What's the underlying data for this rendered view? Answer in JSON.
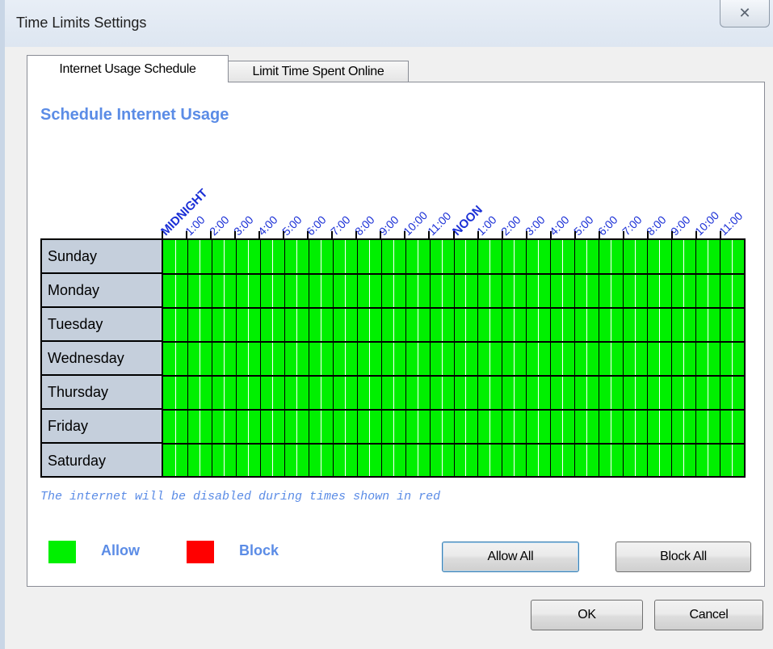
{
  "window": {
    "title": "Time Limits Settings",
    "close_glyph": "✕"
  },
  "tabs": [
    {
      "label": "Internet Usage Schedule",
      "active": true
    },
    {
      "label": "Limit Time Spent Online",
      "active": false
    }
  ],
  "schedule": {
    "title": "Schedule Internet Usage",
    "hour_labels": [
      "MIDNIGHT",
      "1:00",
      "2:00",
      "3:00",
      "4:00",
      "5:00",
      "6:00",
      "7:00",
      "8:00",
      "9:00",
      "10:00",
      "11:00",
      "NOON",
      "1:00",
      "2:00",
      "3:00",
      "4:00",
      "5:00",
      "6:00",
      "7:00",
      "8:00",
      "9:00",
      "10:00",
      "11:00"
    ],
    "days": [
      "Sunday",
      "Monday",
      "Tuesday",
      "Wednesday",
      "Thursday",
      "Friday",
      "Saturday"
    ],
    "slots_per_day": 48,
    "slot_state": "allow",
    "note": "The internet will be disabled during times shown in red"
  },
  "legend": {
    "allow_label": "Allow",
    "block_label": "Block",
    "allow_color": "#00f000",
    "block_color": "#ff0000"
  },
  "buttons": {
    "allow_all": "Allow All",
    "block_all": "Block All",
    "ok": "OK",
    "cancel": "Cancel"
  }
}
